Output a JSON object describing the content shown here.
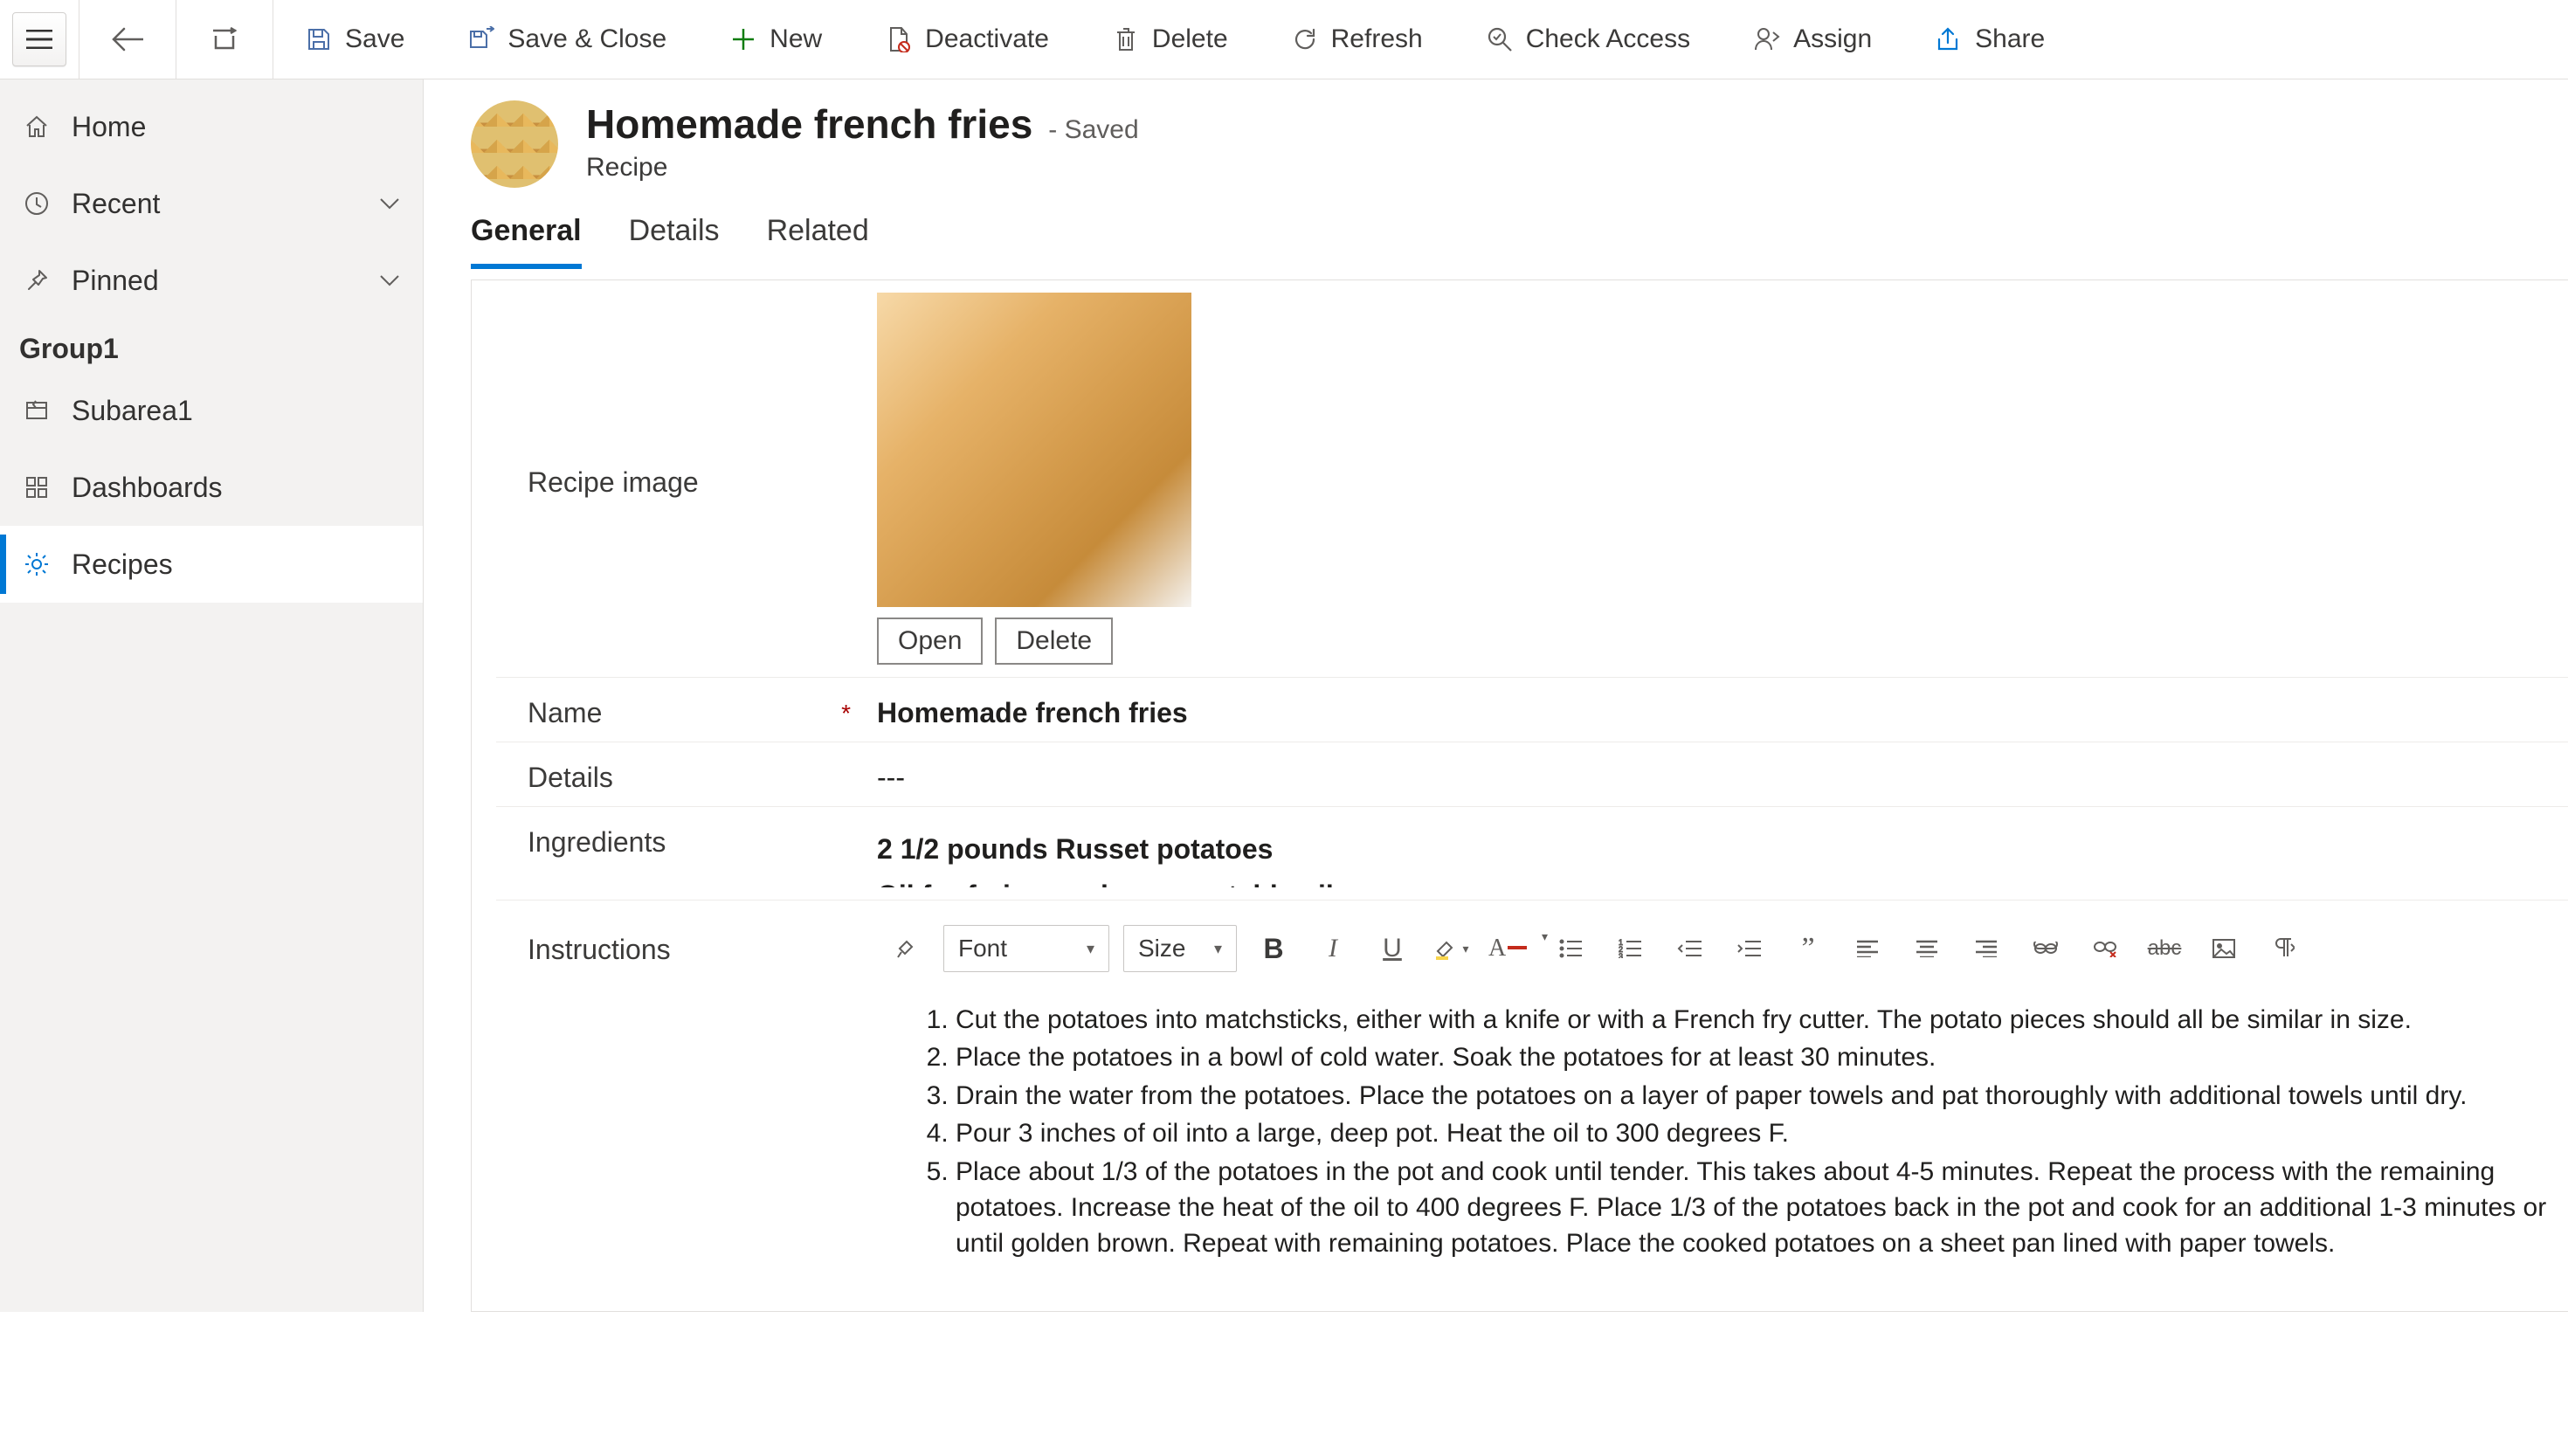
{
  "commandBar": {
    "save": "Save",
    "saveClose": "Save & Close",
    "new": "New",
    "deactivate": "Deactivate",
    "delete": "Delete",
    "refresh": "Refresh",
    "checkAccess": "Check Access",
    "assign": "Assign",
    "share": "Share"
  },
  "nav": {
    "home": "Home",
    "recent": "Recent",
    "pinned": "Pinned",
    "groupHeader": "Group1",
    "subarea1": "Subarea1",
    "dashboards": "Dashboards",
    "recipes": "Recipes"
  },
  "record": {
    "title": "Homemade french fries",
    "status": "- Saved",
    "entity": "Recipe"
  },
  "tabs": {
    "general": "General",
    "details": "Details",
    "related": "Related"
  },
  "fields": {
    "recipeImageLabel": "Recipe image",
    "openBtn": "Open",
    "deleteBtn": "Delete",
    "nameLabel": "Name",
    "nameValue": "Homemade french fries",
    "detailsLabel": "Details",
    "detailsValue": "---",
    "ingredientsLabel": "Ingredients",
    "ingredientsLine1": "2 1/2 pounds Russet potatoes",
    "ingredientsLine2": "Oil for frying such as vegetable oil",
    "instructionsLabel": "Instructions"
  },
  "rte": {
    "font": "Font",
    "size": "Size"
  },
  "instructions": [
    "Cut the potatoes into matchsticks, either with a knife or with a French fry cutter. The potato pieces should all be similar in size.",
    "Place the potatoes in a bowl of cold water. Soak the potatoes for at least 30 minutes.",
    "Drain the water from the potatoes. Place the potatoes on a layer of paper towels and pat thoroughly with additional towels until dry.",
    "Pour 3 inches of oil into a large, deep pot. Heat the oil to 300 degrees F.",
    "Place about 1/3 of the potatoes in the pot and cook until tender. This takes about 4-5 minutes. Repeat the process with the remaining potatoes. Increase the heat of the oil to 400 degrees F. Place 1/3 of the potatoes back in the pot and cook for an additional 1-3 minutes or until golden brown. Repeat with remaining potatoes. Place the cooked potatoes on a sheet pan lined with paper towels."
  ]
}
